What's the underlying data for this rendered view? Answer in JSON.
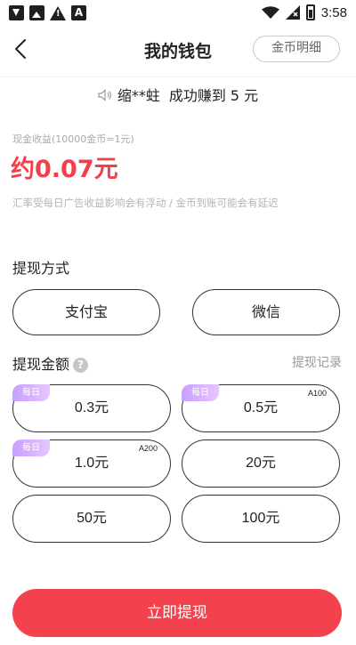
{
  "status_bar": {
    "time": "3:58",
    "icons": [
      "v-app-icon",
      "image-icon",
      "warning-icon",
      "a-app-icon",
      "wifi-icon",
      "signal-icon",
      "battery-icon"
    ]
  },
  "nav": {
    "title": "我的钱包",
    "coin_detail": "金币明细"
  },
  "notice": {
    "user": "缩**蛀",
    "text": "成功赚到 5 元"
  },
  "cash": {
    "label": "现金收益(10000金币=1元)",
    "value": "约0.07元"
  },
  "tip": "汇率受每日广告收益影响会有浮动 / 金币到账可能会有延迟",
  "withdraw_method": {
    "title": "提现方式",
    "options": [
      "支付宝",
      "微信"
    ]
  },
  "withdraw_amount": {
    "title": "提现金额",
    "record": "提现记录",
    "daily_tag": "每日",
    "options": [
      {
        "label": "0.3元",
        "daily": true,
        "corner": ""
      },
      {
        "label": "0.5元",
        "daily": true,
        "corner": "A100"
      },
      {
        "label": "1.0元",
        "daily": true,
        "corner": "A200"
      },
      {
        "label": "20元",
        "daily": false,
        "corner": ""
      },
      {
        "label": "50元",
        "daily": false,
        "corner": ""
      },
      {
        "label": "100元",
        "daily": false,
        "corner": ""
      }
    ]
  },
  "submit": "立即提现",
  "colors": {
    "accent": "#f3424e",
    "daily_tag": "#c8a0ff"
  }
}
